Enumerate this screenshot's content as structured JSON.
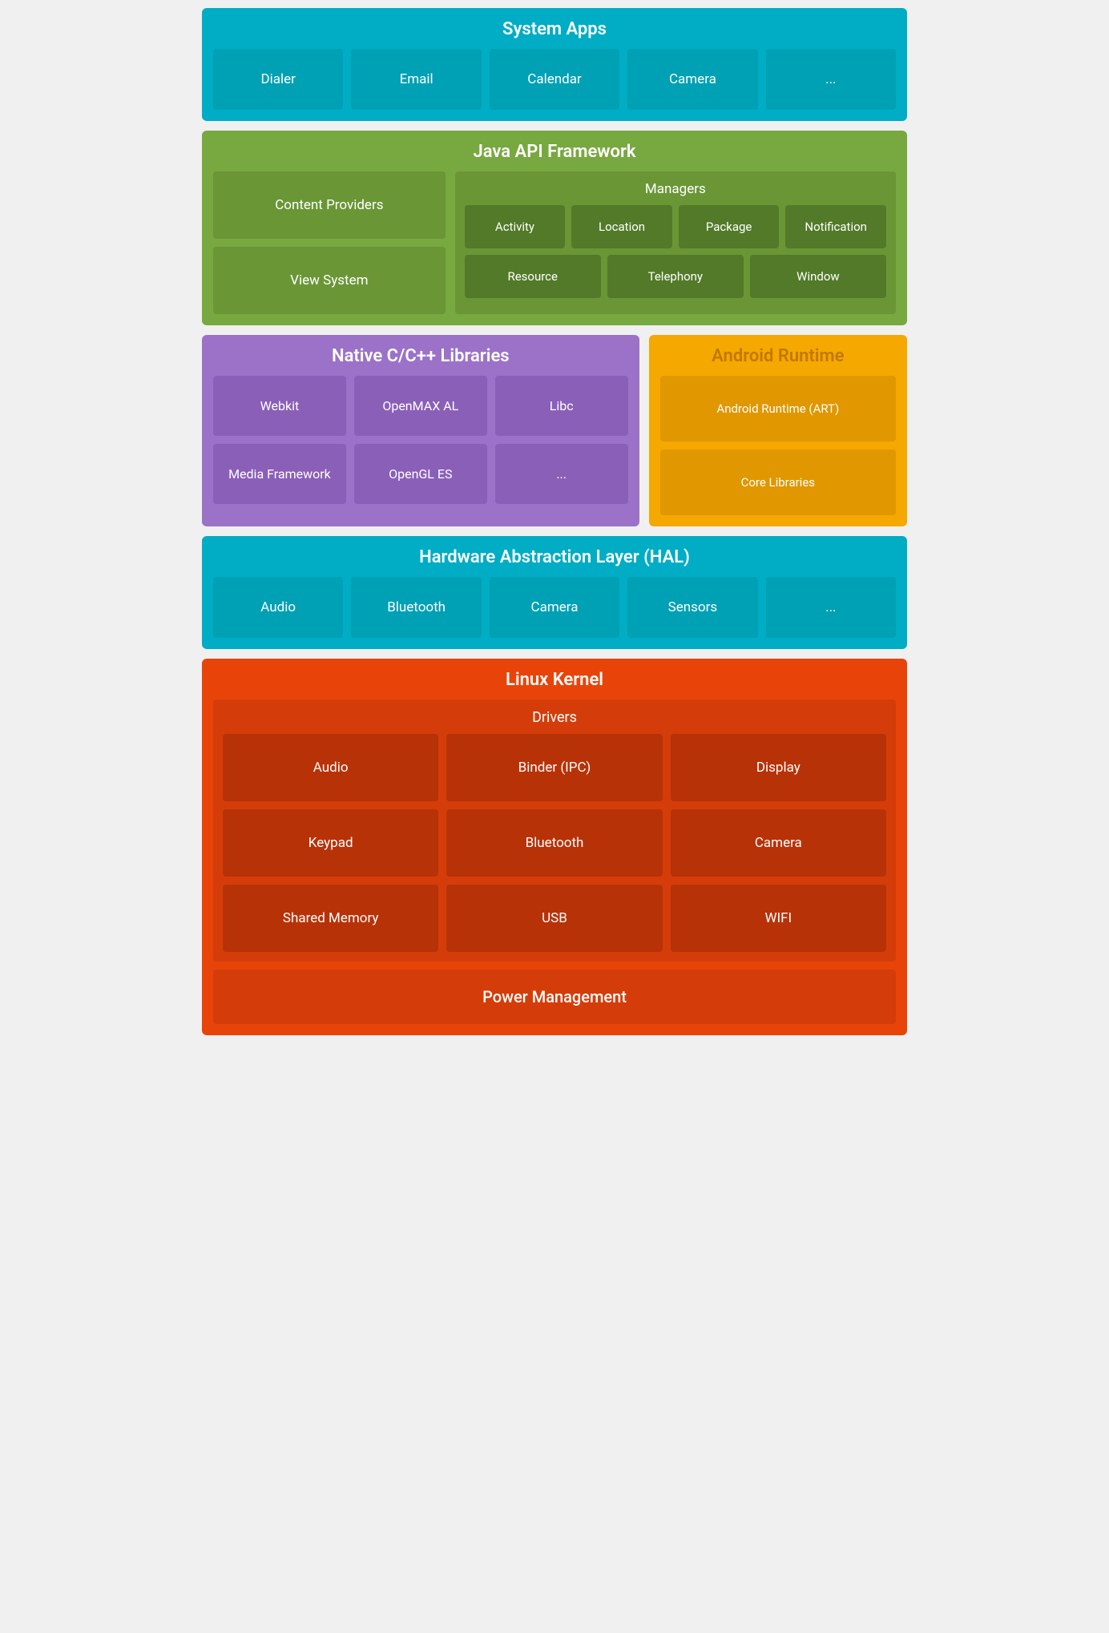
{
  "systemApps": {
    "title": "System Apps",
    "cards": [
      "Dialer",
      "Email",
      "Calendar",
      "Camera",
      "..."
    ]
  },
  "javaApi": {
    "title": "Java API Framework",
    "leftCards": [
      "Content Providers",
      "View System"
    ],
    "managers": {
      "title": "Managers",
      "row1": [
        "Activity",
        "Location",
        "Package",
        "Notification"
      ],
      "row2": [
        "Resource",
        "Telephony",
        "Window"
      ]
    }
  },
  "nativeLibs": {
    "title": "Native C/C++ Libraries",
    "cards": [
      "Webkit",
      "OpenMAX AL",
      "Libc",
      "Media Framework",
      "OpenGL ES",
      "..."
    ]
  },
  "androidRuntime": {
    "title": "Android Runtime",
    "cards": [
      "Android Runtime (ART)",
      "Core Libraries"
    ]
  },
  "hal": {
    "title": "Hardware Abstraction Layer (HAL)",
    "cards": [
      "Audio",
      "Bluetooth",
      "Camera",
      "Sensors",
      "..."
    ]
  },
  "linuxKernel": {
    "title": "Linux Kernel",
    "drivers": {
      "title": "Drivers",
      "cards": [
        "Audio",
        "Binder (IPC)",
        "Display",
        "Keypad",
        "Bluetooth",
        "Camera",
        "Shared Memory",
        "USB",
        "WIFI"
      ]
    },
    "powerManagement": "Power Management"
  }
}
